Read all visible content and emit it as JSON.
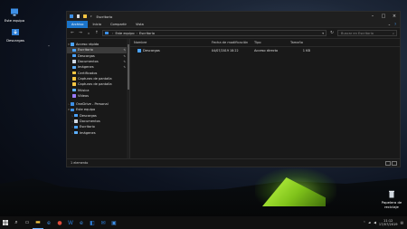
{
  "desktop": {
    "icons": [
      {
        "label": "Este equipo",
        "icon": "computer-icon"
      },
      {
        "label": "Descargas",
        "icon": "download-icon"
      },
      {
        "label": "Papelera de reciclaje",
        "icon": "recycle-bin-icon"
      }
    ]
  },
  "window": {
    "title": "Escritorio",
    "tabs": [
      "Archivo",
      "Inicio",
      "Compartir",
      "Vista"
    ],
    "active_tab_index": 0,
    "address": {
      "root": "Este equipo",
      "current": "Escritorio"
    },
    "search_placeholder": "Buscar en Escritorio",
    "nav": {
      "quick_access": "Acceso rápido",
      "items": [
        {
          "label": "Escritorio",
          "color": "#4aa3ff",
          "pinned": true,
          "selected": true
        },
        {
          "label": "Descargas",
          "color": "#4aa3ff",
          "pinned": true
        },
        {
          "label": "Documentos",
          "color": "#cfd8e3",
          "pinned": true
        },
        {
          "label": "Imágenes",
          "color": "#5db0ff",
          "pinned": true
        },
        {
          "label": "Certificados",
          "color": "#f5c542"
        },
        {
          "label": "Capturas de pantalla",
          "color": "#f5c542"
        },
        {
          "label": "Capturas de pantalla",
          "color": "#f5c542"
        },
        {
          "label": "Música",
          "color": "#5db0ff"
        },
        {
          "label": "Vídeos",
          "color": "#9b7bff"
        }
      ],
      "onedrive": "OneDrive - Personal",
      "this_pc": "Este equipo",
      "pc_items": [
        {
          "label": "Descargas",
          "color": "#4aa3ff"
        },
        {
          "label": "Documentos",
          "color": "#cfd8e3"
        },
        {
          "label": "Escritorio",
          "color": "#4aa3ff"
        },
        {
          "label": "Imágenes",
          "color": "#5db0ff"
        }
      ]
    },
    "columns": {
      "name": "Nombre",
      "modified": "Fecha de modificación",
      "type": "Tipo",
      "size": "Tamaño"
    },
    "files": [
      {
        "name": "Descargas",
        "modified": "04/07/2019 18:22",
        "type": "Acceso directo",
        "size": "1 KB"
      }
    ],
    "status": "1 elemento"
  },
  "taskbar": {
    "time": "11:12",
    "date": "17/07/2019",
    "apps": [
      "start-icon",
      "search-icon",
      "task-view-icon",
      "file-explorer-icon",
      "edge-icon",
      "chrome-icon",
      "word-icon",
      "edge-icon",
      "store-icon",
      "mail-icon",
      "photos-icon"
    ]
  },
  "colors": {
    "accent": "#1a73c9",
    "window_bg": "#191919",
    "taskbar_bg": "#101010"
  }
}
